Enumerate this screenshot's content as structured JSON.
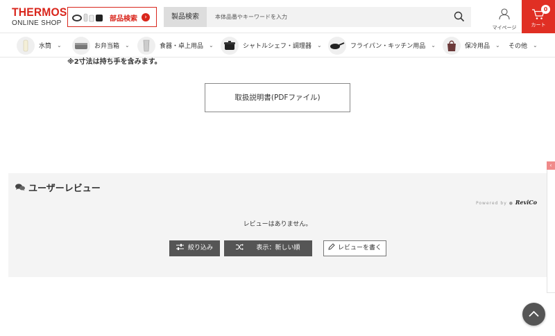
{
  "header": {
    "logo_main": "THERMOS",
    "logo_sub": "ONLINE SHOP",
    "parts_search_label": "部品検索",
    "product_search_tab": "製品検索",
    "search_placeholder": "本体品番やキーワードを入力",
    "mypage_label": "マイページ",
    "cart_label": "カート",
    "cart_count": "0",
    "brand_color": "#d9261c"
  },
  "categories": [
    {
      "label": "水筒",
      "icon": "bottle-icon"
    },
    {
      "label": "お弁当箱",
      "icon": "lunchbox-icon"
    },
    {
      "label": "食器・卓上用品",
      "icon": "tumbler-icon"
    },
    {
      "label": "シャトルシェフ・調理器",
      "icon": "pot-icon"
    },
    {
      "label": "フライパン・キッチン用品",
      "icon": "frypan-icon"
    },
    {
      "label": "保冷用品",
      "icon": "coolerbag-icon"
    },
    {
      "label": "その他",
      "icon": ""
    }
  ],
  "main": {
    "note": "※2寸法は持ち手を含みます。",
    "manual_button": "取扱説明書(PDFファイル)"
  },
  "reviews": {
    "title": "ユーザーレビュー",
    "powered_by": "Powered by",
    "powered_brand": "ReviCo",
    "empty_message": "レビューはありません。",
    "filter_button": "絞り込み",
    "sort_button": "表示：新しい順",
    "write_button": "レビューを書く"
  }
}
